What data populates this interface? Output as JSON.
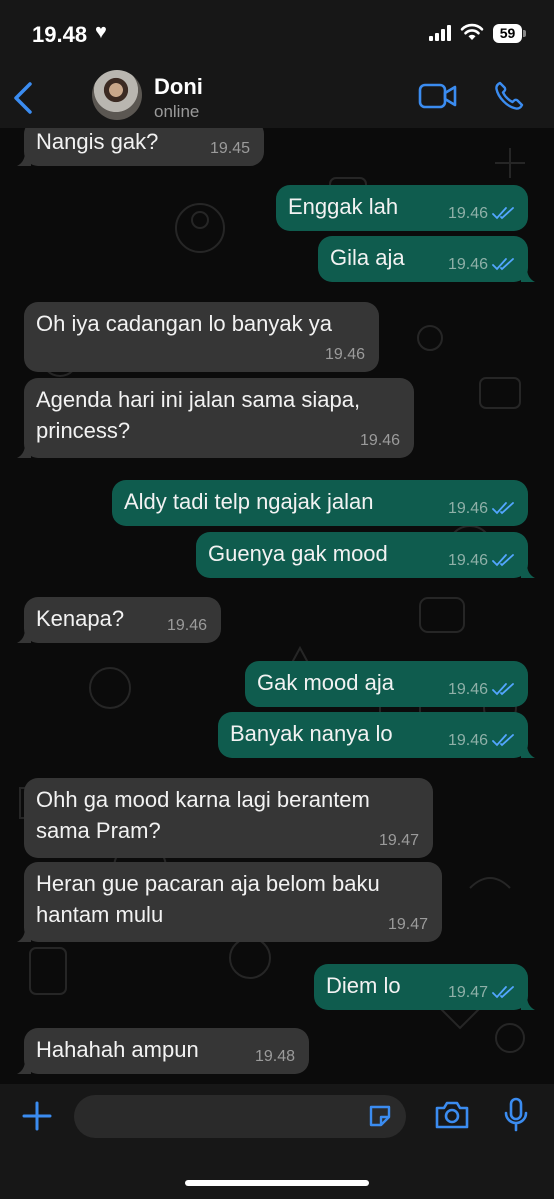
{
  "status_bar": {
    "time": "19.48",
    "battery": "59"
  },
  "header": {
    "name": "Doni",
    "status": "online"
  },
  "colors": {
    "accent": "#3b8cf0",
    "incoming": "#363636",
    "outgoing": "#0f5c4e",
    "tick": "#53a6ff"
  },
  "messages": [
    {
      "dir": "in",
      "lines": [
        "Nangis gak?"
      ],
      "time": "19.45"
    },
    {
      "dir": "out",
      "lines": [
        "Enggak lah"
      ],
      "time": "19.46"
    },
    {
      "dir": "out",
      "lines": [
        "Gila aja"
      ],
      "time": "19.46"
    },
    {
      "dir": "in",
      "lines": [
        "Oh iya cadangan lo banyak ya"
      ],
      "time": "19.46"
    },
    {
      "dir": "in",
      "lines": [
        "Agenda hari ini jalan sama siapa,",
        "princess?"
      ],
      "time": "19.46"
    },
    {
      "dir": "out",
      "lines": [
        "Aldy tadi telp ngajak jalan"
      ],
      "time": "19.46"
    },
    {
      "dir": "out",
      "lines": [
        "Guenya gak mood"
      ],
      "time": "19.46"
    },
    {
      "dir": "in",
      "lines": [
        "Kenapa?"
      ],
      "time": "19.46"
    },
    {
      "dir": "out",
      "lines": [
        "Gak mood aja"
      ],
      "time": "19.46"
    },
    {
      "dir": "out",
      "lines": [
        "Banyak nanya lo"
      ],
      "time": "19.46"
    },
    {
      "dir": "in",
      "lines": [
        "Ohh ga mood karna lagi berantem",
        "sama Pram?"
      ],
      "time": "19.47"
    },
    {
      "dir": "in",
      "lines": [
        "Heran gue pacaran aja belom baku",
        "hantam mulu"
      ],
      "time": "19.47"
    },
    {
      "dir": "out",
      "lines": [
        "Diem lo"
      ],
      "time": "19.47"
    },
    {
      "dir": "in",
      "lines": [
        "Hahahah ampun"
      ],
      "time": "19.48"
    }
  ],
  "icons": {
    "back": "chevron-left-icon",
    "video": "video-camera-icon",
    "call": "phone-icon",
    "plus": "plus-icon",
    "sticker": "sticker-icon",
    "camera": "camera-icon",
    "mic": "microphone-icon",
    "read": "double-check-icon"
  }
}
